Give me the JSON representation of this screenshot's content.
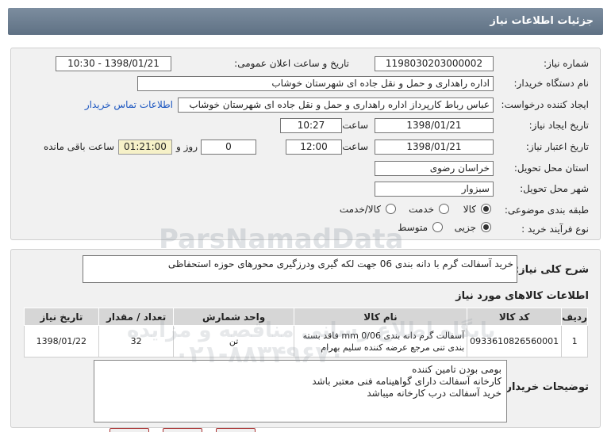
{
  "header": {
    "title": "جزئیات اطلاعات نیاز"
  },
  "form": {
    "need_number_label": "شماره نیاز:",
    "need_number": "1198030203000002",
    "announce_label": "تاریخ و ساعت اعلان عمومی:",
    "announce_value": "1398/01/21 - 10:30",
    "buyer_org_label": "نام دستگاه خریدار:",
    "buyer_org": "اداره راهداری و حمل و نقل جاده ای شهرستان خوشاب",
    "requester_label": "ایجاد کننده درخواست:",
    "requester": "عباس رباط کارپرداز اداره راهداری و حمل و نقل جاده ای شهرستان خوشاب",
    "contact_link": "اطلاعات تماس خریدار",
    "created_label": "تاریخ ایجاد نیاز:",
    "created_date": "1398/01/21",
    "time_label": "ساعت",
    "created_time": "10:27",
    "validity_label": "تاریخ اعتبار نیاز:",
    "validity_date": "1398/01/21",
    "validity_time": "12:00",
    "days_value": "0",
    "days_label": "روز و",
    "remaining_time": "01:21:00",
    "remaining_label": "ساعت باقی مانده",
    "province_label": "استان محل تحویل:",
    "province": "خراسان رضوی",
    "city_label": "شهر محل تحویل:",
    "city": "سبزوار",
    "category_label": "طبقه بندی موضوعی:",
    "category_options": [
      "کالا",
      "خدمت",
      "کالا/خدمت"
    ],
    "process_label": "نوع فرآیند خرید :",
    "process_options": [
      "جزیی",
      "متوسط"
    ]
  },
  "summary": {
    "label": "شرح کلی نیاز:",
    "text": "خرید آسفالت گرم با دانه بندی 06 جهت لکه گیری ودرزگیری محورهای حوزه استحفاظی"
  },
  "goods": {
    "title": "اطلاعات کالاهای مورد نیاز",
    "headers": [
      "ردیف",
      "کد کالا",
      "نام کالا",
      "واحد شمارش",
      "تعداد / مقدار",
      "تاریخ نیاز"
    ],
    "rows": [
      {
        "row": "1",
        "code": "0933610826560001",
        "name": "آسفالت گرم دانه بندی mm 0/06 فاقد بسته بندی تنی مرجع عرضه کننده سلیم بهرام",
        "unit": "تن",
        "qty": "32",
        "date": "1398/01/22"
      }
    ]
  },
  "buyer_notes": {
    "label": "توضیحات خریدار:",
    "lines": [
      "بومی بودن تامین کننده",
      "کارخانه آسفالت دارای گواهینامه فنی معتبر باشد",
      "خرید آسفالت درب کارخانه میباشد"
    ]
  },
  "watermark": {
    "brand": "ParsNamadData",
    "line1": "پایگاه اطلاع رسانی مناقصه و مزایده",
    "phone": "۰۲۱-۸۸۳۴۹۶۷۰"
  }
}
